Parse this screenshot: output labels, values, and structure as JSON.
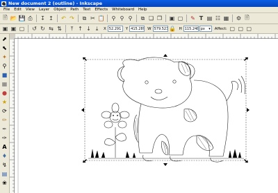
{
  "window": {
    "title": "New document 2 (outline) - Inkscape"
  },
  "menu": [
    "File",
    "Edit",
    "View",
    "Layer",
    "Object",
    "Path",
    "Text",
    "Effects",
    "Whiteboard",
    "Help"
  ],
  "controls": {
    "x_label": "X",
    "x_value": "52.291",
    "y_label": "Y",
    "y_value": "415.289",
    "w_label": "W",
    "w_value": "579.523",
    "h_label": "H",
    "h_value": "115.248",
    "unit": "px",
    "affect_label": "Affect:"
  },
  "icons": {
    "command": [
      "new-icon",
      "open-icon",
      "save-icon",
      "print-icon",
      "import-icon",
      "export-icon",
      "undo-icon",
      "redo-icon",
      "copy-icon",
      "cut-icon",
      "paste-icon",
      "zoom-selection-icon",
      "zoom-drawing-icon",
      "zoom-page-icon",
      "duplicate-icon",
      "clone-icon",
      "unlink-clone-icon",
      "group-icon",
      "ungroup-icon",
      "fill-stroke-icon",
      "text-tool-icon",
      "layers-icon",
      "xml-editor-icon",
      "align-icon",
      "preferences-icon",
      "document-properties-icon"
    ],
    "tools": [
      "selector-icon",
      "node-icon",
      "tweak-icon",
      "zoom-icon",
      "rect-icon",
      "3d-box-icon",
      "ellipse-icon",
      "star-icon",
      "spiral-icon",
      "pencil-icon",
      "pen-icon",
      "calligraphy-icon",
      "text-icon",
      "spray-icon",
      "connector-icon",
      "gradient-icon",
      "dropper-icon"
    ]
  },
  "colors": {
    "titlebar": "#0a5de6",
    "chrome": "#ece9d8",
    "canvas": "#ffffff"
  }
}
